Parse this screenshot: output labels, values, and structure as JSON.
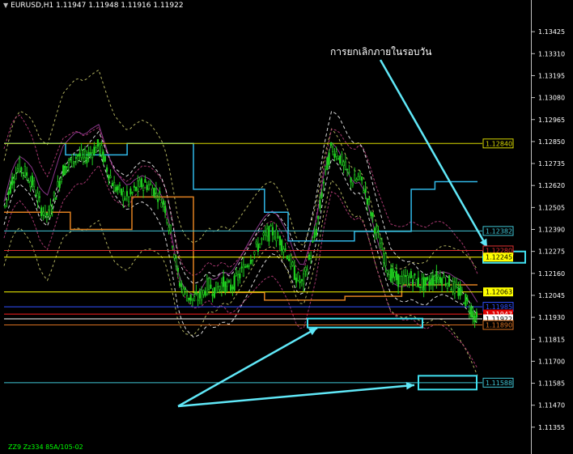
{
  "window": {
    "symbol_line": "EURUSD,H1  1.11947 1.11948 1.11916 1.11922",
    "footer": "ZZ9 Zz334 85A/105-02"
  },
  "annotation": "การยกเลิกภายในรอบวัน",
  "chart_data": {
    "type": "candlestick",
    "title": "EURUSD,H1",
    "ohlc_last": {
      "open": 1.11947,
      "high": 1.11948,
      "low": 1.11916,
      "close": 1.11922
    },
    "ylim": [
      1.1124,
      1.1354
    ],
    "y_ticks": [
      1.13425,
      1.1331,
      1.13195,
      1.1308,
      1.12965,
      1.1285,
      1.12735,
      1.1262,
      1.12505,
      1.1239,
      1.12275,
      1.1216,
      1.12045,
      1.1193,
      1.11815,
      1.117,
      1.11585,
      1.1147,
      1.11355
    ],
    "level_lines": [
      {
        "value": 1.1284,
        "label": "1.12840",
        "color": "#d8d800"
      },
      {
        "value": 1.12382,
        "label": "1.12382",
        "color": "#40c8d8"
      },
      {
        "value": 1.1228,
        "label": "1.12280",
        "color": "#e03030"
      },
      {
        "value": 1.12245,
        "label": "1.12245",
        "color": "#ffff00"
      },
      {
        "value": 1.12063,
        "label": "1.12063",
        "color": "#ffff00"
      },
      {
        "value": 1.11985,
        "label": "1.11985",
        "color": "#3050ff"
      },
      {
        "value": 1.11947,
        "label": "1.11947",
        "color": "#ff2020"
      },
      {
        "value": 1.11922,
        "label": "1.11922",
        "color": "#ffffff"
      },
      {
        "value": 1.1189,
        "label": "1.11890",
        "color": "#d87020"
      },
      {
        "value": 1.11588,
        "label": "1.11588",
        "color": "#40c8d8"
      }
    ],
    "price_path": [
      1.1251,
      1.1265,
      1.1272,
      1.1268,
      1.1262,
      1.125,
      1.1246,
      1.1258,
      1.127,
      1.1274,
      1.1278,
      1.1276,
      1.128,
      1.1283,
      1.1272,
      1.1262,
      1.1258,
      1.1255,
      1.126,
      1.1263,
      1.1262,
      1.1258,
      1.1252,
      1.1235,
      1.1212,
      1.1205,
      1.1202,
      1.1204,
      1.121,
      1.1207,
      1.1211,
      1.1208,
      1.1213,
      1.1219,
      1.1225,
      1.1231,
      1.1236,
      1.1238,
      1.1233,
      1.1226,
      1.1215,
      1.121,
      1.1224,
      1.124,
      1.1266,
      1.1282,
      1.1278,
      1.127,
      1.1264,
      1.1266,
      1.1255,
      1.124,
      1.1228,
      1.1216,
      1.1213,
      1.1212,
      1.1214,
      1.1211,
      1.121,
      1.1213,
      1.1214,
      1.1212,
      1.1208,
      1.1205,
      1.1199,
      1.1192
    ],
    "cyan_step": [
      {
        "x0": 0.0,
        "x1": 0.13,
        "v": 1.1284
      },
      {
        "x0": 0.13,
        "x1": 0.26,
        "v": 1.1278
      },
      {
        "x0": 0.26,
        "x1": 0.4,
        "v": 1.1284
      },
      {
        "x0": 0.4,
        "x1": 0.55,
        "v": 1.126
      },
      {
        "x0": 0.55,
        "x1": 0.6,
        "v": 1.1248
      },
      {
        "x0": 0.6,
        "x1": 0.74,
        "v": 1.1233
      },
      {
        "x0": 0.74,
        "x1": 0.86,
        "v": 1.1238
      },
      {
        "x0": 0.86,
        "x1": 0.91,
        "v": 1.126
      },
      {
        "x0": 0.91,
        "x1": 1.0,
        "v": 1.1264
      }
    ],
    "orange_step": [
      {
        "x0": 0.0,
        "x1": 0.14,
        "v": 1.1248
      },
      {
        "x0": 0.14,
        "x1": 0.27,
        "v": 1.1239
      },
      {
        "x0": 0.27,
        "x1": 0.4,
        "v": 1.1256
      },
      {
        "x0": 0.4,
        "x1": 0.55,
        "v": 1.1206
      },
      {
        "x0": 0.55,
        "x1": 0.72,
        "v": 1.1202
      },
      {
        "x0": 0.72,
        "x1": 0.84,
        "v": 1.1204
      },
      {
        "x0": 0.84,
        "x1": 1.0,
        "v": 1.121
      }
    ],
    "highlight_boxes": [
      {
        "name": "box-1.12245",
        "price": 1.12245
      },
      {
        "name": "box-1.11930",
        "price": 1.119
      },
      {
        "name": "box-1.11588",
        "price": 1.11588
      }
    ]
  }
}
